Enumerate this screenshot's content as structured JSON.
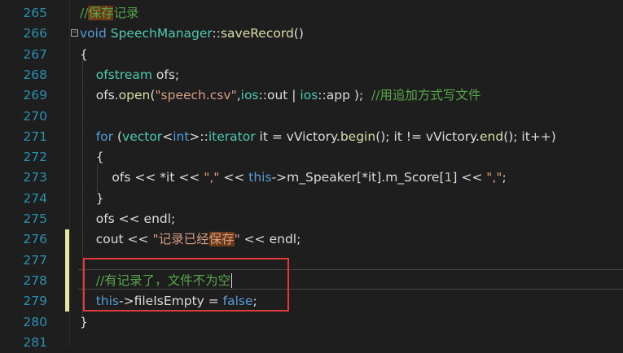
{
  "lines": [
    {
      "num": "265",
      "tokens": [
        {
          "t": "//",
          "c": "cm"
        },
        {
          "t": "保存",
          "c": "cm",
          "hl": true
        },
        {
          "t": "记录",
          "c": "cm"
        }
      ]
    },
    {
      "num": "266",
      "tokens": [
        {
          "t": "void ",
          "c": "kw"
        },
        {
          "t": "SpeechManager",
          "c": "ty"
        },
        {
          "t": "::",
          "c": "id"
        },
        {
          "t": "saveRecord",
          "c": "fn"
        },
        {
          "t": "()",
          "c": "id"
        }
      ]
    },
    {
      "num": "267",
      "tokens": [
        {
          "t": "{",
          "c": "id"
        }
      ]
    },
    {
      "num": "268",
      "tokens": [
        {
          "t": "    ",
          "c": "id"
        },
        {
          "t": "ofstream ",
          "c": "ty"
        },
        {
          "t": "ofs;",
          "c": "id"
        }
      ]
    },
    {
      "num": "269",
      "tokens": [
        {
          "t": "    ofs.",
          "c": "id"
        },
        {
          "t": "open",
          "c": "fn"
        },
        {
          "t": "(",
          "c": "id"
        },
        {
          "t": "\"speech.csv\"",
          "c": "st"
        },
        {
          "t": ",",
          "c": "id"
        },
        {
          "t": "ios",
          "c": "ty"
        },
        {
          "t": "::out | ",
          "c": "id"
        },
        {
          "t": "ios",
          "c": "ty"
        },
        {
          "t": "::app );  ",
          "c": "id"
        },
        {
          "t": "//用追加方式写文件",
          "c": "cm"
        }
      ]
    },
    {
      "num": "270",
      "tokens": []
    },
    {
      "num": "271",
      "tokens": [
        {
          "t": "    ",
          "c": "id"
        },
        {
          "t": "for",
          "c": "kw"
        },
        {
          "t": " (",
          "c": "id"
        },
        {
          "t": "vector",
          "c": "ty"
        },
        {
          "t": "<",
          "c": "id"
        },
        {
          "t": "int",
          "c": "kw"
        },
        {
          "t": ">",
          "c": "id"
        },
        {
          "t": "::",
          "c": "id"
        },
        {
          "t": "iterator",
          "c": "ty"
        },
        {
          "t": " it = vVictory.",
          "c": "id"
        },
        {
          "t": "begin",
          "c": "fn"
        },
        {
          "t": "(); it != vVictory.",
          "c": "id"
        },
        {
          "t": "end",
          "c": "fn"
        },
        {
          "t": "(); it++)",
          "c": "id"
        }
      ]
    },
    {
      "num": "272",
      "tokens": [
        {
          "t": "    {",
          "c": "id"
        }
      ]
    },
    {
      "num": "273",
      "tokens": [
        {
          "t": "        ofs << *it << ",
          "c": "id"
        },
        {
          "t": "\",\"",
          "c": "st"
        },
        {
          "t": " << ",
          "c": "id"
        },
        {
          "t": "this",
          "c": "kw"
        },
        {
          "t": "->m_Speaker[*it].m_Score[",
          "c": "id"
        },
        {
          "t": "1",
          "c": "nm"
        },
        {
          "t": "] << ",
          "c": "id"
        },
        {
          "t": "\",\"",
          "c": "st"
        },
        {
          "t": ";",
          "c": "id"
        }
      ]
    },
    {
      "num": "274",
      "tokens": [
        {
          "t": "    }",
          "c": "id"
        }
      ]
    },
    {
      "num": "275",
      "tokens": [
        {
          "t": "    ofs << endl;",
          "c": "id"
        }
      ]
    },
    {
      "num": "276",
      "tokens": [
        {
          "t": "    cout << ",
          "c": "id"
        },
        {
          "t": "\"记录已经",
          "c": "st"
        },
        {
          "t": "保存",
          "c": "st",
          "hl": true
        },
        {
          "t": "\"",
          "c": "st"
        },
        {
          "t": " << endl;",
          "c": "id"
        }
      ]
    },
    {
      "num": "277",
      "tokens": []
    },
    {
      "num": "278",
      "tokens": [
        {
          "t": "    ",
          "c": "id"
        },
        {
          "t": "//有记录了，文件不为空",
          "c": "cm"
        }
      ],
      "caret": true
    },
    {
      "num": "279",
      "tokens": [
        {
          "t": "    ",
          "c": "id"
        },
        {
          "t": "this",
          "c": "kw"
        },
        {
          "t": "->fileIsEmpty = ",
          "c": "id"
        },
        {
          "t": "false",
          "c": "kw"
        },
        {
          "t": ";",
          "c": "id"
        }
      ]
    },
    {
      "num": "280",
      "tokens": [
        {
          "t": "}",
          "c": "id"
        }
      ]
    },
    {
      "num": "281",
      "tokens": []
    }
  ],
  "fold_glyph": "⊟",
  "colors": {
    "background": "#1e1e1e",
    "line_number": "#2b91af",
    "comment": "#57a64a",
    "keyword": "#569cd6",
    "type": "#4ec9b0",
    "function": "#dcdcaa",
    "string": "#d69d85",
    "highlight": "#6b3b18",
    "annotation_box": "#e03b3b"
  }
}
